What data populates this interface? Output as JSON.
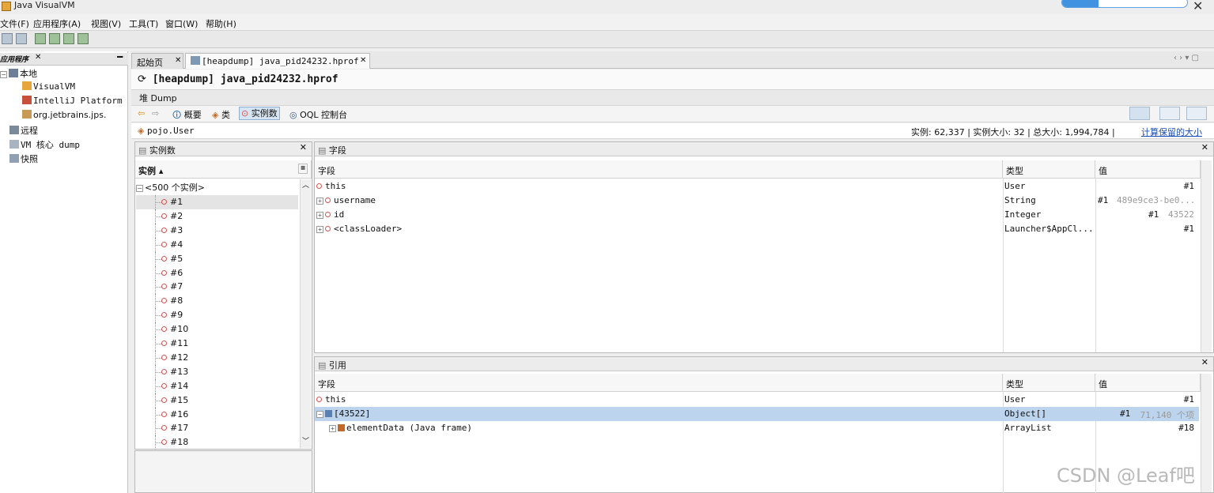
{
  "window": {
    "title": "Java VisualVM",
    "close_glyph": "✕"
  },
  "menu": [
    "文件(F)",
    "应用程序(A)",
    "视图(V)",
    "工具(T)",
    "窗口(W)",
    "帮助(H)"
  ],
  "left_panel": {
    "tab_label": "应用程序",
    "tab_close": "✕",
    "minimize": "━",
    "tree": [
      {
        "label": "本地",
        "icon": "computer-icon"
      },
      {
        "label": "VisualVM",
        "icon": "java-app-icon"
      },
      {
        "label": "IntelliJ Platform",
        "icon": "intellij-icon"
      },
      {
        "label": "org.jetbrains.jps.",
        "icon": "java-app-icon"
      },
      {
        "label": "远程",
        "icon": "remote-host-icon"
      },
      {
        "label": "VM 核心 dump",
        "icon": "core-dump-icon"
      },
      {
        "label": "快照",
        "icon": "snapshot-icon"
      }
    ]
  },
  "tabs": [
    {
      "label": "起始页",
      "close": "✕"
    },
    {
      "label": "[heapdump] java_pid24232.hprof",
      "close": "✕"
    }
  ],
  "tab_controls": "‹ › ▾ ▢",
  "header": {
    "title": "[heapdump] java_pid24232.hprof"
  },
  "subtoolbar": {
    "label": "堆 Dump"
  },
  "nav": {
    "summary": "概要",
    "classes": "类",
    "instances": "实例数",
    "oql": "OQL 控制台"
  },
  "class_bar": {
    "class_name": "pojo.User",
    "stats": "实例: 62,337  |  实例大小: 32  |  总大小: 1,994,784  |",
    "link": "计算保留的大小"
  },
  "instances_panel": {
    "title": "实例数",
    "close": "✕",
    "header": "实例 ▴",
    "group": "<500 个实例>",
    "items": [
      "#1",
      "#2",
      "#3",
      "#4",
      "#5",
      "#6",
      "#7",
      "#8",
      "#9",
      "#10",
      "#11",
      "#12",
      "#13",
      "#14",
      "#15",
      "#16",
      "#17",
      "#18"
    ]
  },
  "fields_panel": {
    "title": "字段",
    "close": "✕",
    "columns": [
      "字段",
      "类型",
      "值"
    ],
    "rows": [
      {
        "name": "this",
        "type": "User",
        "ref": "#1",
        "extra": ""
      },
      {
        "name": "username",
        "type": "String",
        "ref": "#1",
        "extra": "489e9ce3-be0..."
      },
      {
        "name": "id",
        "type": "Integer",
        "ref": "#1",
        "extra": "43522"
      },
      {
        "name": "<classLoader>",
        "type": "Launcher$AppCl...",
        "ref": "#1",
        "extra": ""
      }
    ]
  },
  "refs_panel": {
    "title": "引用",
    "close": "✕",
    "columns": [
      "字段",
      "类型",
      "值"
    ],
    "rows": [
      {
        "name": "this",
        "type": "User",
        "ref": "#1",
        "extra": ""
      },
      {
        "name": "[43522]",
        "type": "Object[]",
        "ref": "#1",
        "extra": "71,140 个项"
      },
      {
        "name": "elementData (Java frame)",
        "type": "ArrayList",
        "ref": "#18",
        "extra": ""
      }
    ]
  },
  "watermark": "CSDN @Leaf吧",
  "colors": {
    "selection": "#bcd4ee",
    "link": "#1a4fb7",
    "accent": "#3f93e0"
  }
}
